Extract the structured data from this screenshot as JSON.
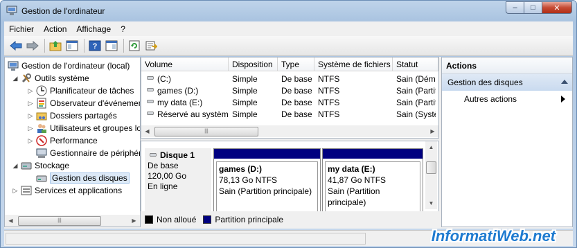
{
  "window": {
    "title": "Gestion de l'ordinateur",
    "minimize_glyph": "–",
    "maximize_glyph": "□",
    "close_glyph": "✕"
  },
  "menu": [
    "Fichier",
    "Action",
    "Affichage",
    "?"
  ],
  "toolbar": {
    "icons": [
      "back-arrow-icon",
      "forward-arrow-icon",
      "up-folder-icon",
      "show-hide-tree-icon",
      "help-icon",
      "properties-pane-icon",
      "refresh-icon",
      "export-icon"
    ]
  },
  "tree": {
    "root": "Gestion de l'ordinateur (local)",
    "outils": "Outils système",
    "planificateur": "Planificateur de tâches",
    "observateur": "Observateur d'événements",
    "dossiers": "Dossiers partagés",
    "utilisateurs": "Utilisateurs et groupes locaux",
    "performance": "Performance",
    "gestionnaire": "Gestionnaire de périphériques",
    "stockage": "Stockage",
    "gestion_disques": "Gestion des disques",
    "services": "Services et applications"
  },
  "volumes": {
    "headers": {
      "volume": "Volume",
      "disposition": "Disposition",
      "type": "Type",
      "fs": "Système de fichiers",
      "statut": "Statut"
    },
    "rows": [
      {
        "volume": "(C:)",
        "disposition": "Simple",
        "type": "De base",
        "fs": "NTFS",
        "statut": "Sain (Démarrer)"
      },
      {
        "volume": "games (D:)",
        "disposition": "Simple",
        "type": "De base",
        "fs": "NTFS",
        "statut": "Sain (Partition principale)"
      },
      {
        "volume": "my data (E:)",
        "disposition": "Simple",
        "type": "De base",
        "fs": "NTFS",
        "statut": "Sain (Partition principale)"
      },
      {
        "volume": "Réservé au système",
        "disposition": "Simple",
        "type": "De base",
        "fs": "NTFS",
        "statut": "Sain (Système)"
      }
    ]
  },
  "disk": {
    "name": "Disque 1",
    "type": "De base",
    "size": "120,00 Go",
    "state": "En ligne",
    "partitions": [
      {
        "name": "games  (D:)",
        "size": "78,13 Go NTFS",
        "status": "Sain (Partition principale)"
      },
      {
        "name": "my data  (E:)",
        "size": "41,87 Go NTFS",
        "status": "Sain (Partition principale)"
      }
    ]
  },
  "legend": {
    "unallocated": "Non alloué",
    "primary": "Partition principale",
    "unallocated_color": "#000000",
    "primary_color": "#000080"
  },
  "actions": {
    "header": "Actions",
    "section": "Gestion des disques",
    "more": "Autres actions"
  },
  "watermark": "InformatiWeb.net"
}
